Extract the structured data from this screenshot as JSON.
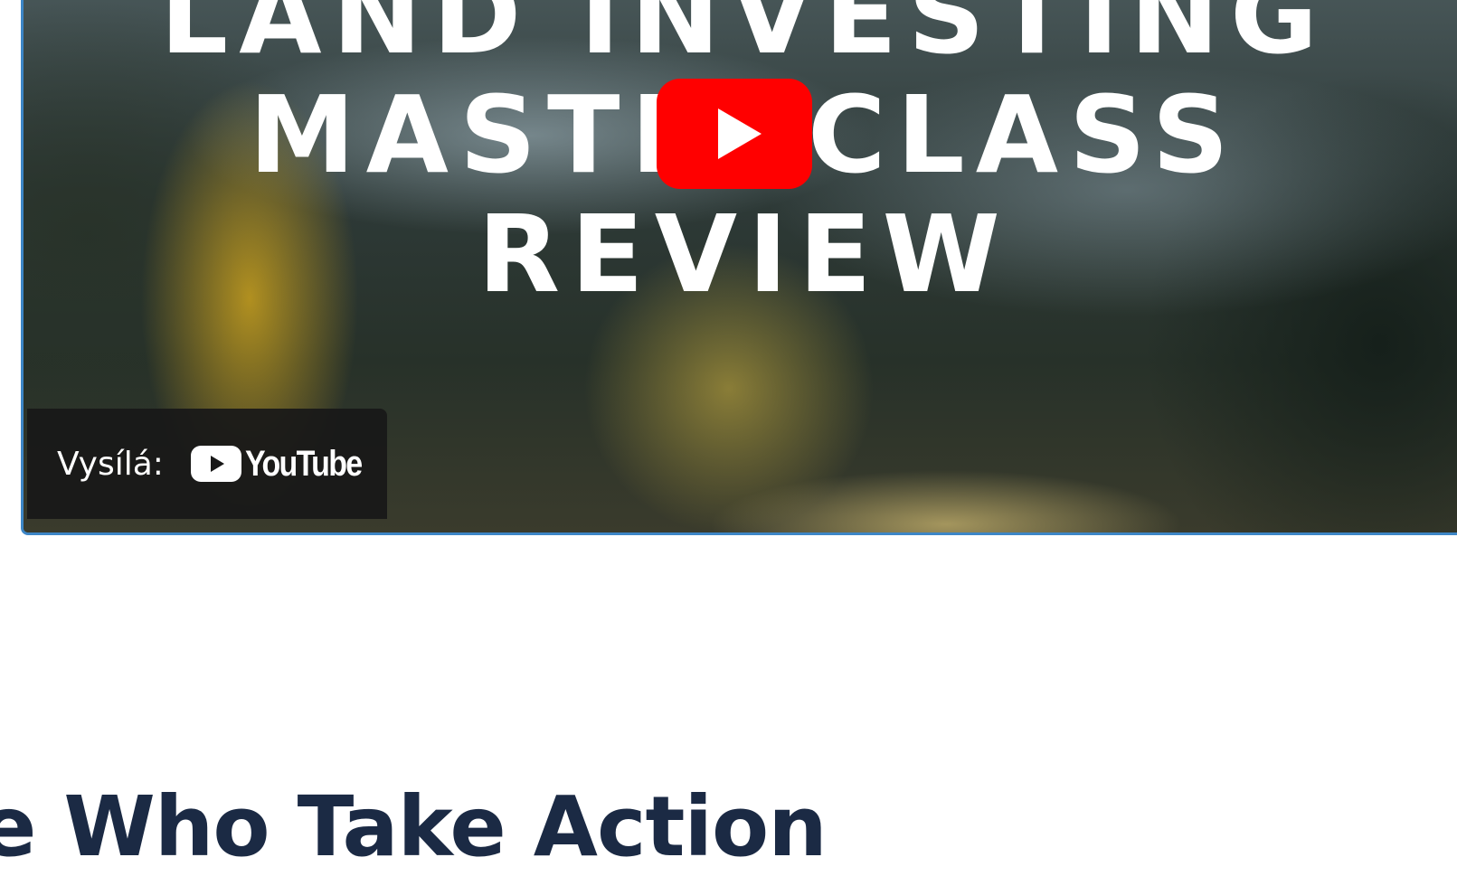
{
  "video": {
    "thumbnail_title_lines": [
      "LAND INVESTING",
      "MASTERCLASS",
      "REVIEW"
    ],
    "play_icon": "play-icon",
    "watch_label": "Vysílá:",
    "provider_name": "YouTube",
    "provider_icon": "youtube-logo-icon",
    "frame_color": "#3d86c6",
    "play_color": "#ff0000"
  },
  "section": {
    "heading": "e Who Take Action",
    "heading_color": "#1b2a44"
  }
}
